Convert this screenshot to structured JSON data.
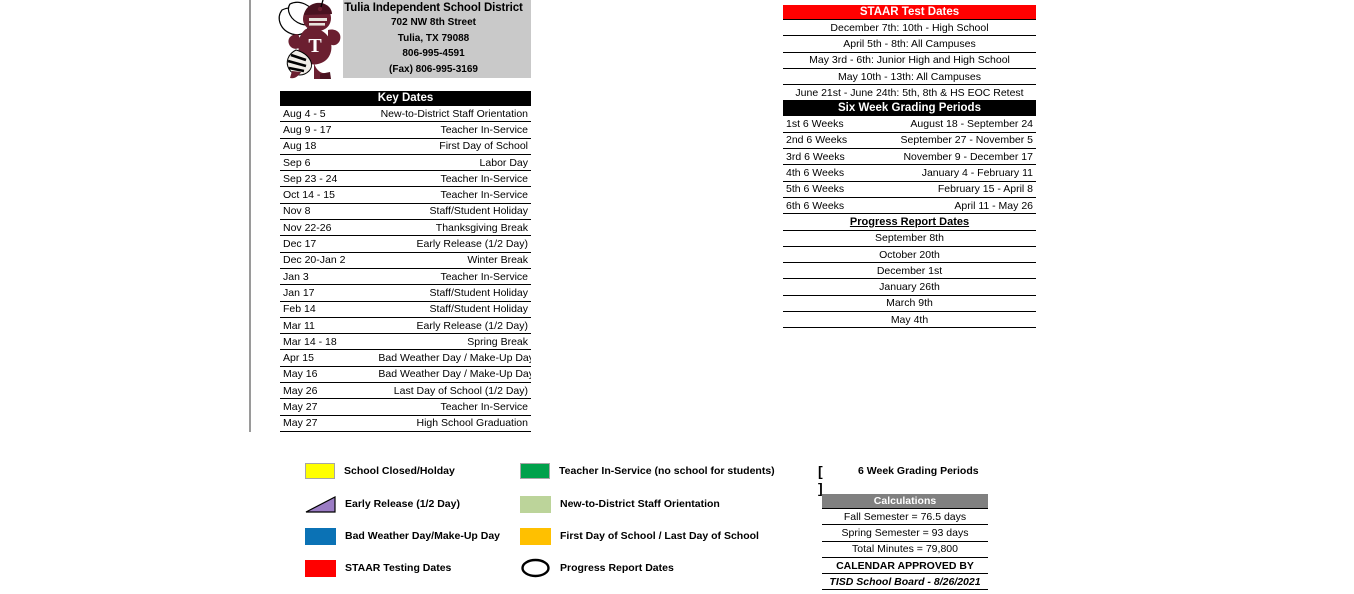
{
  "masthead": {
    "district_name": "Tulia Independent School District",
    "address_lines": [
      "702 NW 8th Street",
      "Tulia, TX 79088",
      "806-995-4591",
      "(Fax) 806-995-3169"
    ],
    "mascot_icon": "hornet-mascot-icon",
    "mascot_jersey_letter": "T",
    "mascot_color": "#6b1f30",
    "bg_color": "#c9c9c9"
  },
  "key_dates": {
    "title": "Key Dates",
    "rows": [
      {
        "date": "Aug 4 - 5",
        "event": "New-to-District Staff Orientation"
      },
      {
        "date": "Aug 9 - 17",
        "event": "Teacher In-Service"
      },
      {
        "date": "Aug 18",
        "event": "First Day of School"
      },
      {
        "date": "Sep 6",
        "event": "Labor Day"
      },
      {
        "date": "Sep 23 - 24",
        "event": "Teacher In-Service"
      },
      {
        "date": "Oct 14 - 15",
        "event": "Teacher In-Service"
      },
      {
        "date": "Nov 8",
        "event": "Staff/Student Holiday"
      },
      {
        "date": "Nov 22-26",
        "event": "Thanksgiving Break"
      },
      {
        "date": "Dec 17",
        "event": "Early Release (1/2 Day)"
      },
      {
        "date": "Dec 20-Jan 2",
        "event": "Winter Break"
      },
      {
        "date": "Jan 3",
        "event": "Teacher In-Service"
      },
      {
        "date": "Jan 17",
        "event": "Staff/Student Holiday"
      },
      {
        "date": "Feb 14",
        "event": "Staff/Student Holiday"
      },
      {
        "date": "Mar 11",
        "event": "Early Release (1/2 Day)"
      },
      {
        "date": "Mar 14 - 18",
        "event": "Spring Break"
      },
      {
        "date": "Apr 15",
        "event": "Bad Weather Day / Make-Up Day"
      },
      {
        "date": "May 16",
        "event": "Bad Weather Day / Make-Up Day"
      },
      {
        "date": "May 26",
        "event": "Last Day of School (1/2 Day)"
      },
      {
        "date": "May 27",
        "event": "Teacher In-Service"
      },
      {
        "date": "May 27",
        "event": "High School Graduation"
      }
    ]
  },
  "staar": {
    "title": "STAAR Test Dates",
    "header_bg": "#ff0000",
    "rows": [
      "December 7th: 10th - High School",
      "April 5th - 8th: All Campuses",
      "May 3rd - 6th: Junior High and High School",
      "May 10th - 13th: All Campuses",
      "June 21st - June 24th: 5th, 8th & HS EOC Retest"
    ]
  },
  "six_weeks": {
    "title": "Six Week Grading Periods",
    "rows": [
      {
        "period": "1st 6 Weeks",
        "range": "August 18 - September 24"
      },
      {
        "period": "2nd 6 Weeks",
        "range": "September 27 - November 5"
      },
      {
        "period": "3rd 6 Weeks",
        "range": "November 9 - December 17"
      },
      {
        "period": "4th 6 Weeks",
        "range": "January 4 - February 11"
      },
      {
        "period": "5th 6 Weeks",
        "range": "February 15 - April 8"
      },
      {
        "period": "6th 6 Weeks",
        "range": "April 11 - May 26"
      }
    ]
  },
  "progress_reports": {
    "title": "Progress Report Dates",
    "rows": [
      "September 8th",
      "October 20th",
      "December 1st",
      "January 26th",
      "March 9th",
      "May 4th"
    ]
  },
  "legend": {
    "items": [
      {
        "label": "School Closed/Holday",
        "swatch": "yellow-square-icon",
        "color": "#ffff00"
      },
      {
        "label": "Early Release (1/2 Day)",
        "swatch": "purple-triangle-icon",
        "color": "#9b7cc4"
      },
      {
        "label": "Bad Weather Day/Make-Up Day",
        "swatch": "blue-square-icon",
        "color": "#0b72b5"
      },
      {
        "label": "STAAR Testing Dates",
        "swatch": "red-square-icon",
        "color": "#ff0000"
      },
      {
        "label": "Teacher In-Service (no school for students)",
        "swatch": "green-square-icon",
        "color": "#00a14b"
      },
      {
        "label": "New-to-District Staff Orientation",
        "swatch": "lightgreen-square-icon",
        "color": "#bcd49a"
      },
      {
        "label": "First Day of School / Last Day of School",
        "swatch": "orange-square-icon",
        "color": "#ffc000"
      },
      {
        "label": "Progress Report Dates",
        "swatch": "oval-outline-icon",
        "color": "#000000"
      },
      {
        "label": "6 Week Grading Periods",
        "swatch": "brackets-icon",
        "color": "#000000",
        "glyph": "[    ]"
      }
    ]
  },
  "calculations": {
    "title": "Calculations",
    "header_bg": "#808080",
    "rows": [
      "Fall Semester = 76.5 days",
      "Spring Semester = 93 days",
      "Total Minutes  = 79,800"
    ],
    "approved_label": "CALENDAR APPROVED BY",
    "approved_by": "TISD School Board -  8/26/2021"
  }
}
